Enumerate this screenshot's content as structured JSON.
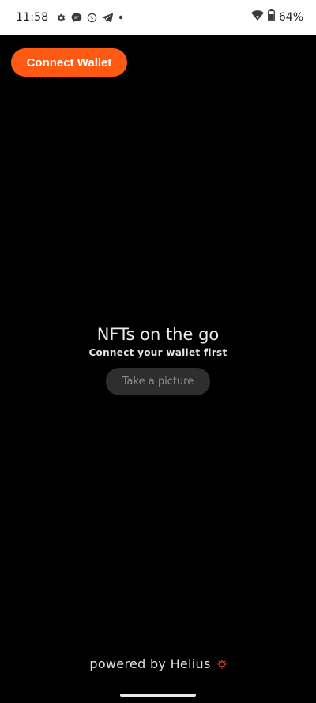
{
  "status_bar": {
    "time": "11:58",
    "left_icons": [
      "gear-icon",
      "chat-bubble-icon",
      "whatsapp-icon",
      "telegram-icon",
      "dot-icon"
    ],
    "right_icons": [
      "wifi-icon",
      "battery-icon"
    ],
    "battery_percent": "64%"
  },
  "header": {
    "connect_label": "Connect Wallet",
    "accent_color": "#ff5a14"
  },
  "hero": {
    "title": "NFTs on the go",
    "subtitle": "Connect your wallet first",
    "picture_button_label": "Take a picture",
    "picture_button_enabled": false
  },
  "footer": {
    "text": "powered by Helius",
    "icon": "helius-sun-icon",
    "icon_color": "#e8462e"
  }
}
